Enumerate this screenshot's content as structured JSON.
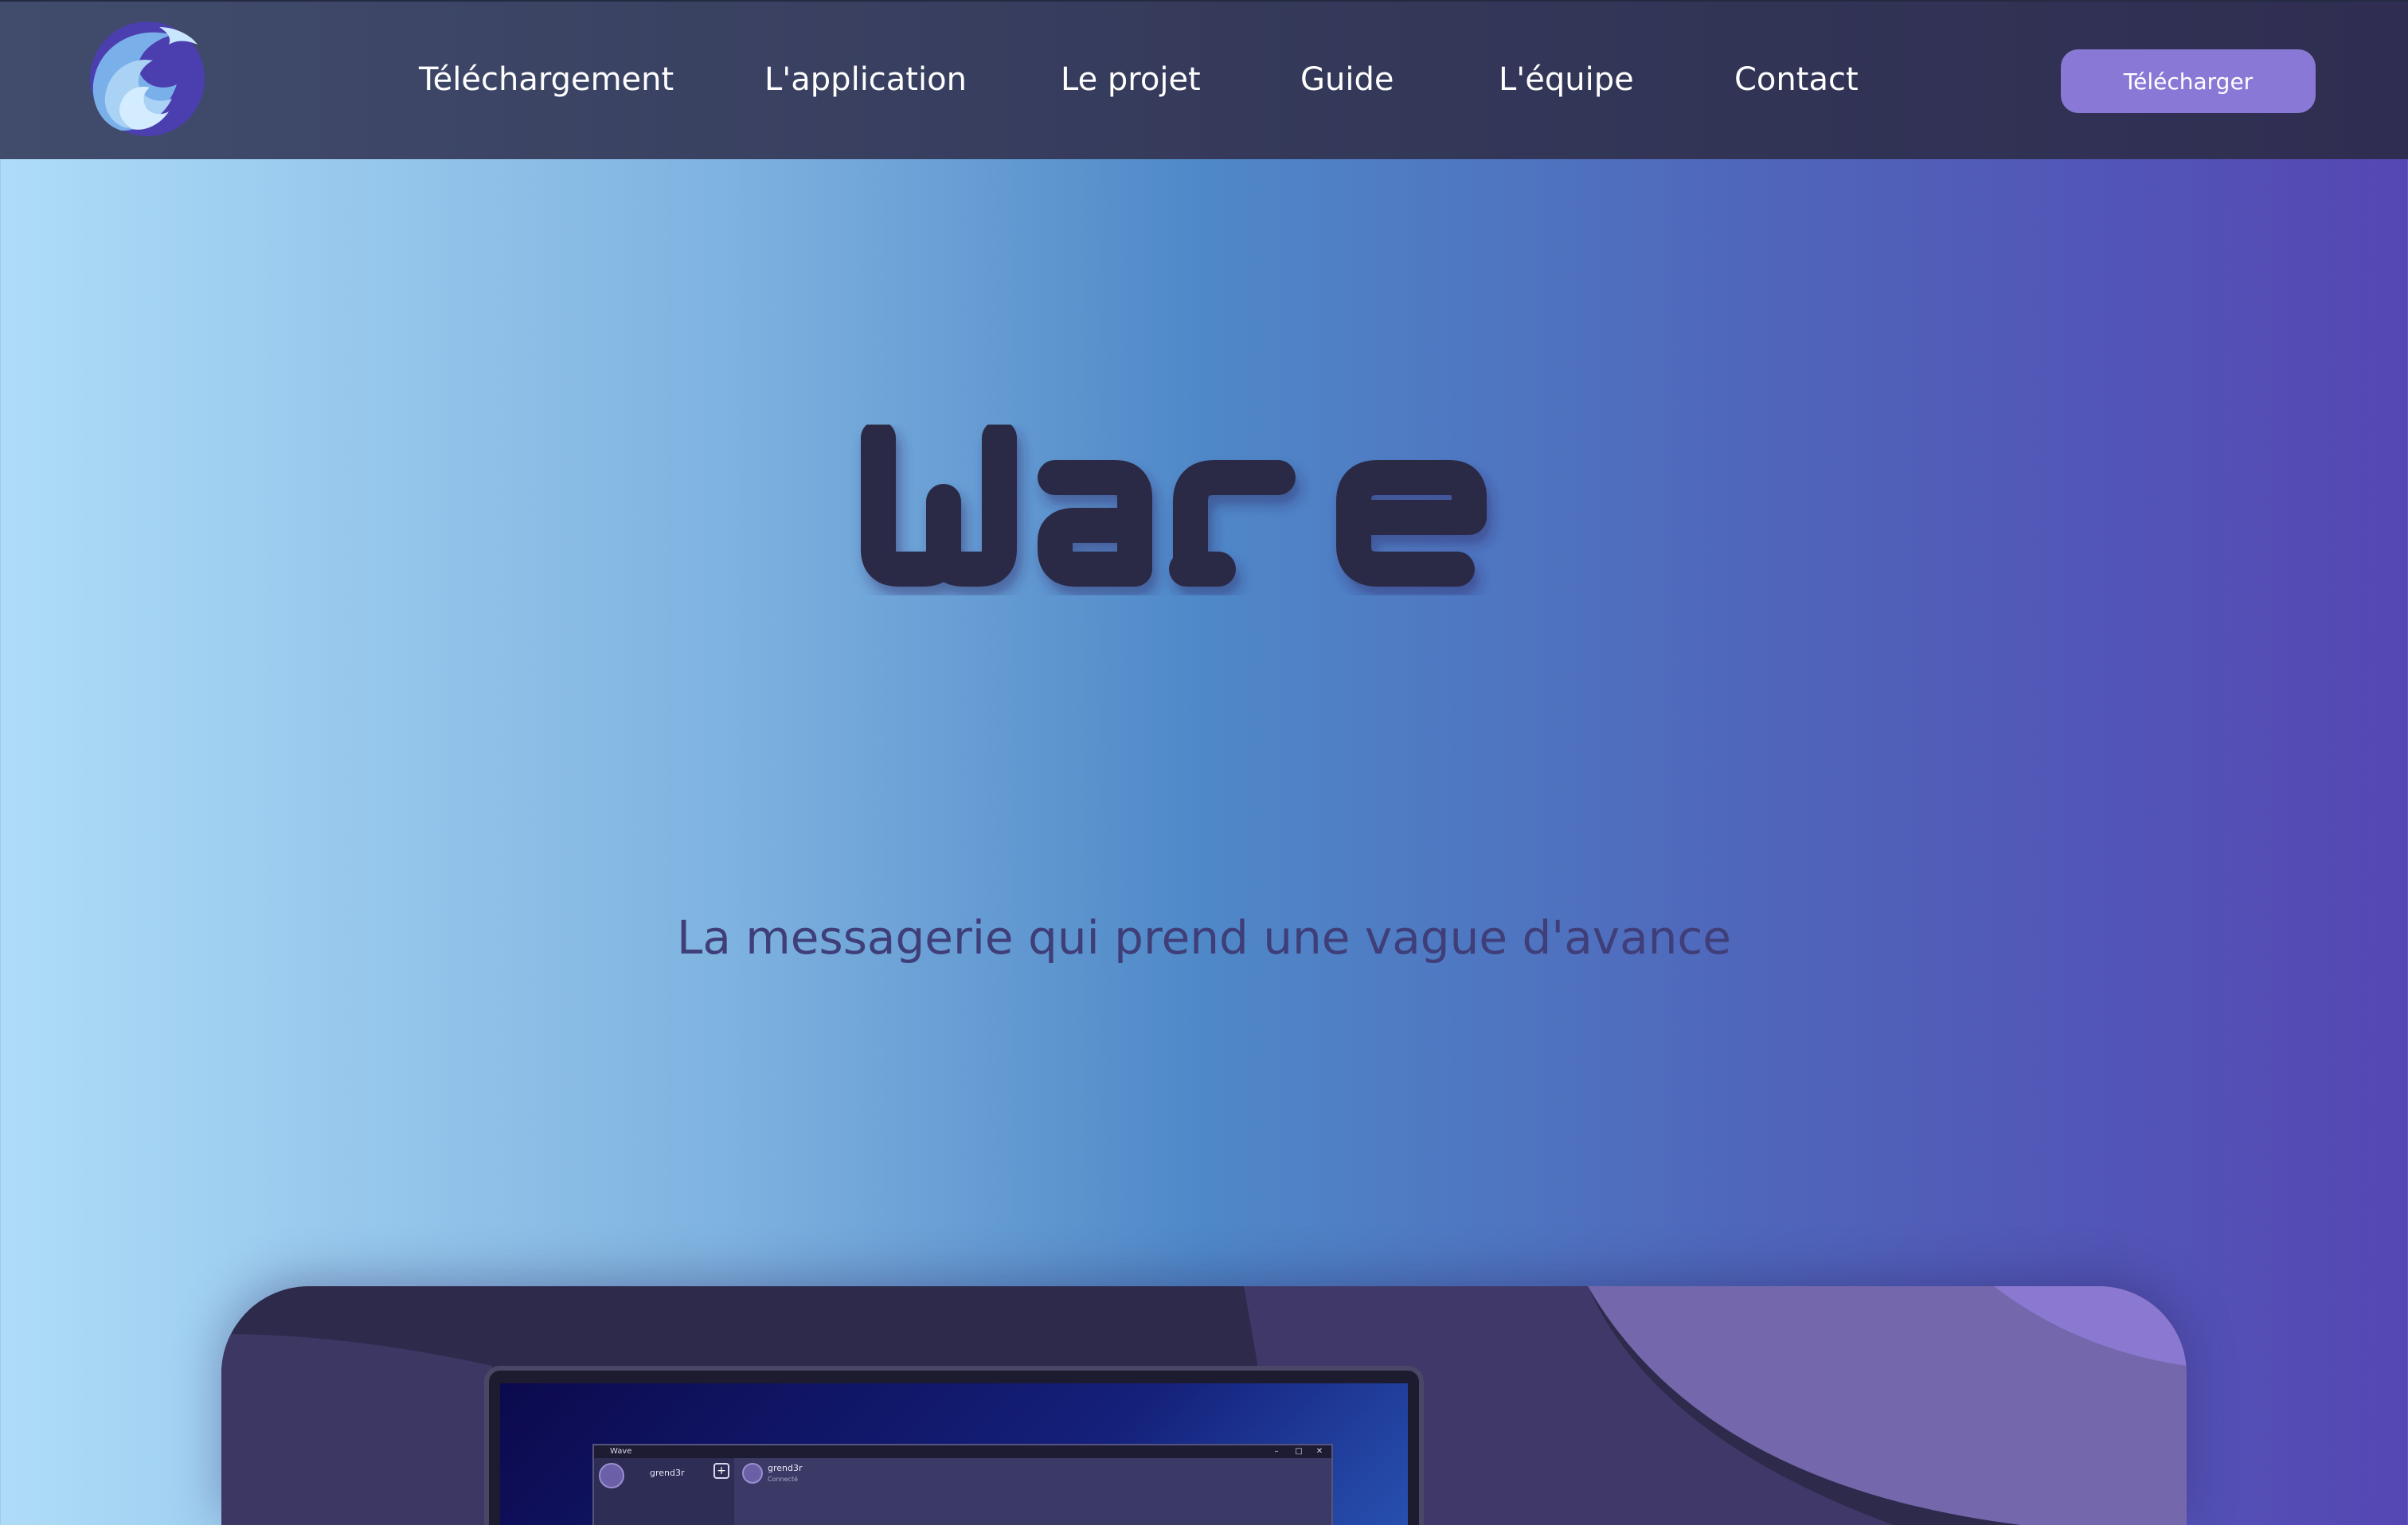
{
  "brand": {
    "name": "Wave",
    "colors": {
      "accent": "#8a78d6",
      "title": "#2c2946",
      "tagline": "#3f3e78"
    }
  },
  "nav": {
    "links": [
      {
        "label": "Téléchargement"
      },
      {
        "label": "L'application"
      },
      {
        "label": "Le projet"
      },
      {
        "label": "Guide"
      },
      {
        "label": "L'équipe"
      },
      {
        "label": "Contact"
      }
    ],
    "cta_label": "Télécharger"
  },
  "hero": {
    "title": "Wave",
    "tagline": "La messagerie qui prend une vague d'avance"
  },
  "preview": {
    "window_title": "Wave",
    "username": "grend3r",
    "chat_name": "grend3r",
    "chat_status": "Connecté",
    "window_controls": [
      "–",
      "□",
      "✕"
    ],
    "add_icon": "+"
  }
}
